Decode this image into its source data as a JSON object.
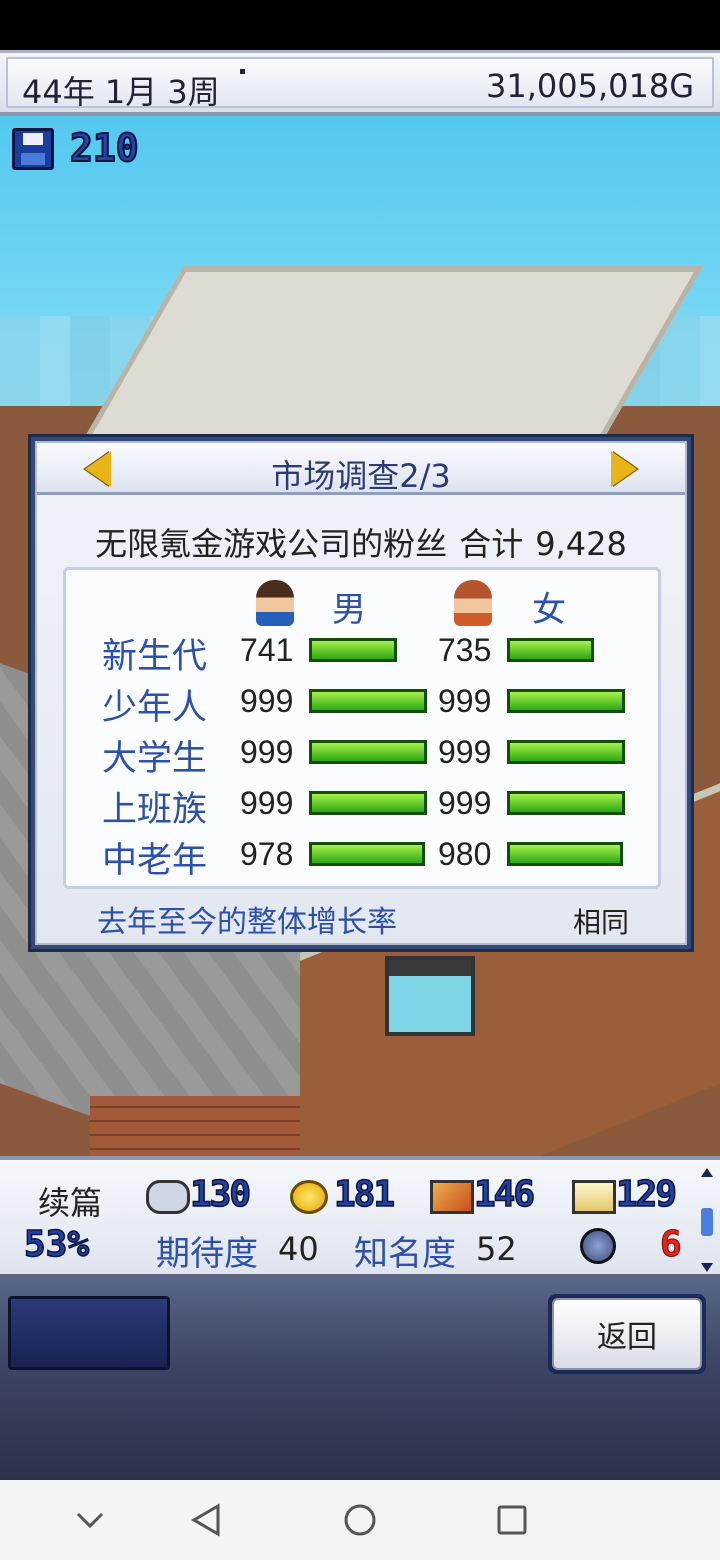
{
  "top": {
    "date": "44年 1月 3周",
    "money": "31,005,018G"
  },
  "save_count": "210",
  "dialog": {
    "title": "市场调查2/3",
    "fans_label": "无限氪金游戏公司的粉丝",
    "total_label": "合计",
    "total_value": "9,428",
    "male_label": "男",
    "female_label": "女",
    "rows": [
      {
        "name": "新生代",
        "male": 741,
        "female": 735
      },
      {
        "name": "少年人",
        "male": 999,
        "female": 999
      },
      {
        "name": "大学生",
        "male": 999,
        "female": 999
      },
      {
        "name": "上班族",
        "male": 999,
        "female": 999
      },
      {
        "name": "中老年",
        "male": 978,
        "female": 980
      }
    ],
    "bar_max": 999,
    "growth_label": "去年至今的整体增长率",
    "growth_value": "相同"
  },
  "info": {
    "sequel_label": "续篇",
    "sequel_pct": "53%",
    "stats": [
      {
        "icon": "gamepad-icon",
        "value": "130"
      },
      {
        "icon": "coin-icon",
        "value": "181"
      },
      {
        "icon": "graphics-icon",
        "value": "146"
      },
      {
        "icon": "sound-icon",
        "value": "129"
      }
    ],
    "expectation_label": "期待度",
    "expectation_value": "40",
    "fame_label": "知名度",
    "fame_value": "52",
    "bug_icon": "bug-icon",
    "bug_count": "6"
  },
  "back_label": "返回",
  "colors": {
    "accent_blue": "#2d50a8",
    "bar_green": "#2da80f",
    "bug_red": "#e8231c"
  }
}
